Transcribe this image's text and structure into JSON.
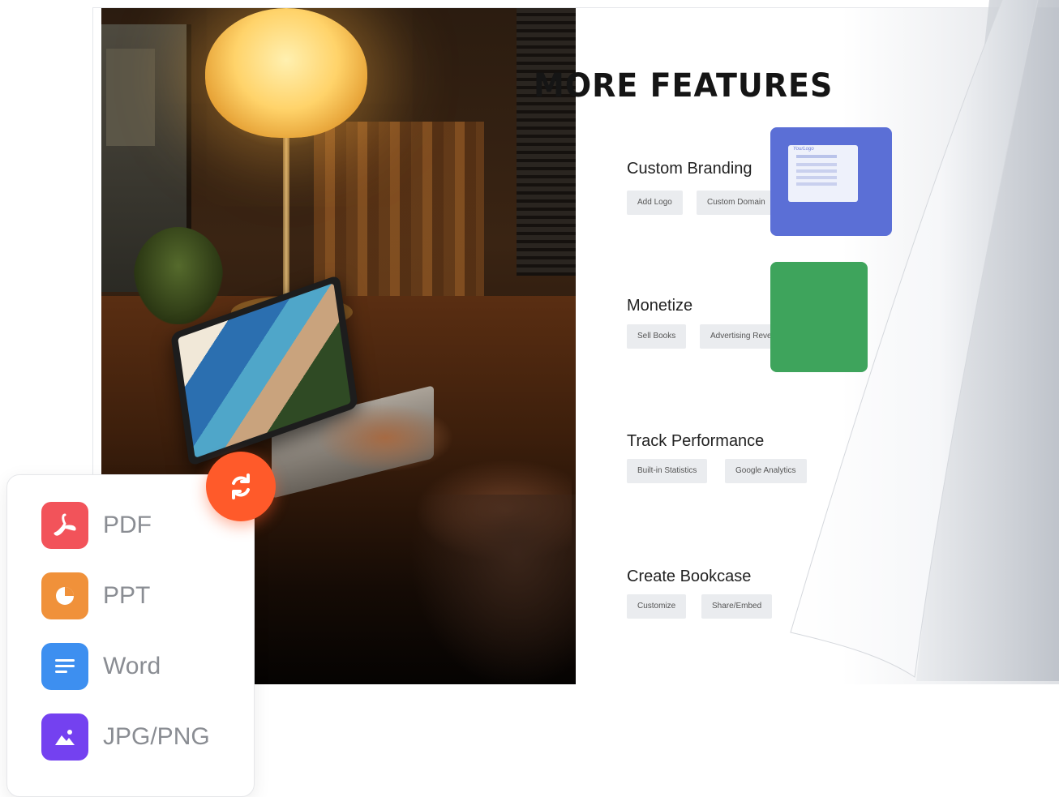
{
  "page": {
    "title": "MORE FEATURES",
    "features": [
      {
        "title": "Custom Branding",
        "tags": [
          "Add Logo",
          "Custom Domain"
        ]
      },
      {
        "title": "Monetize",
        "tags": [
          "Sell Books",
          "Advertising Revenue"
        ]
      },
      {
        "title": "Track Performance",
        "tags": [
          "Built-in Statistics",
          "Google Analytics"
        ]
      },
      {
        "title": "Create Bookcase",
        "tags": [
          "Customize",
          "Share/Embed"
        ]
      }
    ],
    "thumb_label": "YourLogo"
  },
  "formats": [
    {
      "label": "PDF",
      "icon": "pdf-icon",
      "color": "#f2535a"
    },
    {
      "label": "PPT",
      "icon": "ppt-icon",
      "color": "#f0913a"
    },
    {
      "label": "Word",
      "icon": "word-icon",
      "color": "#3d8ff0"
    },
    {
      "label": "JPG/PNG",
      "icon": "image-icon",
      "color": "#7441f0"
    }
  ],
  "convert_button": {
    "icon": "convert-icon",
    "color": "#ff5a2a"
  }
}
